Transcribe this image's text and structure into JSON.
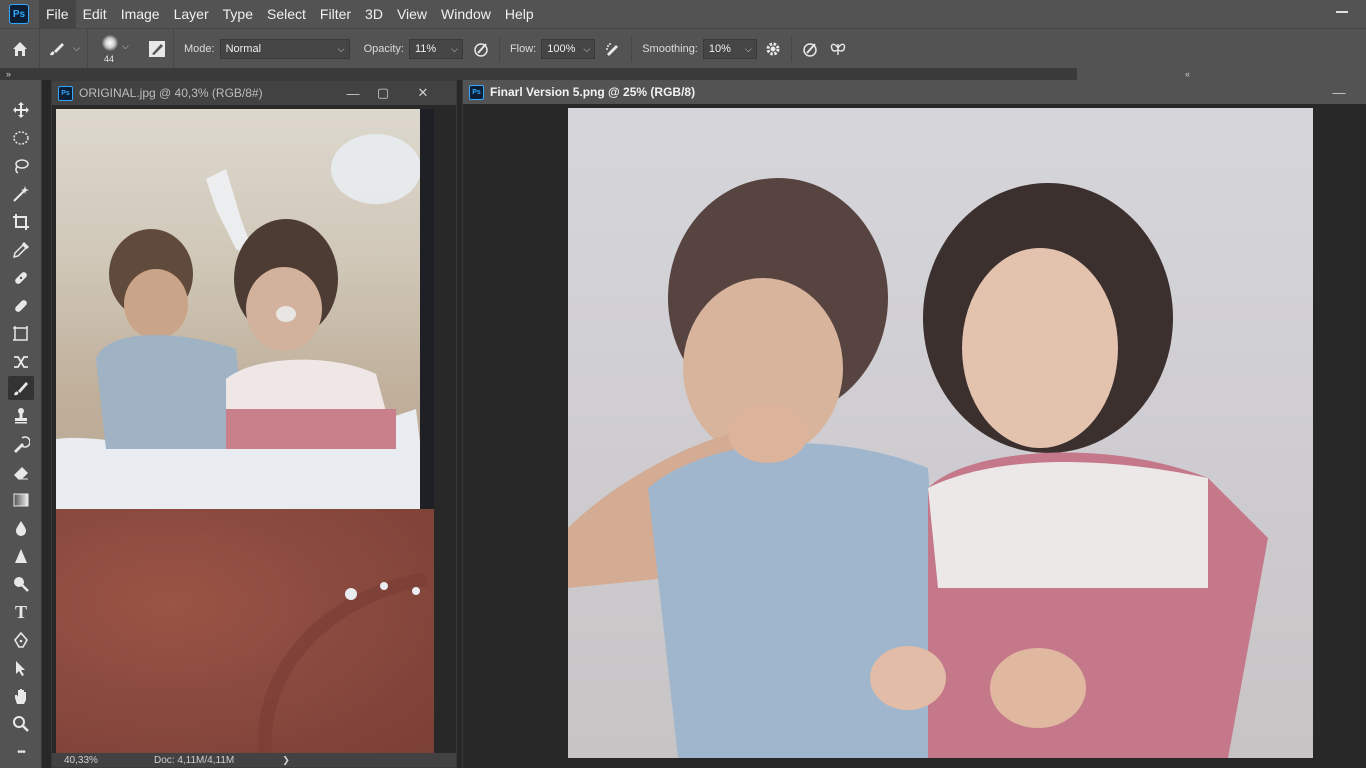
{
  "menubar": {
    "items": [
      "File",
      "Edit",
      "Image",
      "Layer",
      "Type",
      "Select",
      "Filter",
      "3D",
      "View",
      "Window",
      "Help"
    ],
    "app_logo": "Ps",
    "active_item": "File"
  },
  "options": {
    "brush_size": "44",
    "mode_label": "Mode:",
    "mode_value": "Normal",
    "opacity_label": "Opacity:",
    "opacity_value": "11%",
    "flow_label": "Flow:",
    "flow_value": "100%",
    "smoothing_label": "Smoothing:",
    "smoothing_value": "10%"
  },
  "tools": {
    "items": [
      "move-tool",
      "elliptical-marquee-tool",
      "lasso-tool",
      "magic-wand-tool",
      "crop-tool",
      "eyedropper-tool",
      "healing-brush-tool",
      "patch-tool",
      "frame-tool",
      "content-aware-move-tool",
      "brush-tool",
      "clone-stamp-tool",
      "history-brush-tool",
      "eraser-tool",
      "gradient-tool",
      "blur-tool",
      "sharpen-tool",
      "dodge-tool",
      "type-tool",
      "pen-tool",
      "path-selection-tool",
      "hand-tool",
      "zoom-tool",
      "more-tools"
    ],
    "active": "brush-tool",
    "type_glyph": "T",
    "more_glyph": "•••"
  },
  "documents": {
    "left": {
      "icon": "Ps",
      "title": "ORIGINAL.jpg @ 40,3% (RGB/8#)",
      "zoom": "40,33%",
      "doc_info": "Doc: 4,11M/4,11M"
    },
    "right": {
      "icon": "Ps",
      "title": "Finarl Version 5.png @ 25% (RGB/8)"
    }
  },
  "colors": {
    "chrome": "#535353",
    "panel_dark": "#282828",
    "ps_blue": "#31a8ff",
    "ps_navy": "#0b1e33"
  }
}
